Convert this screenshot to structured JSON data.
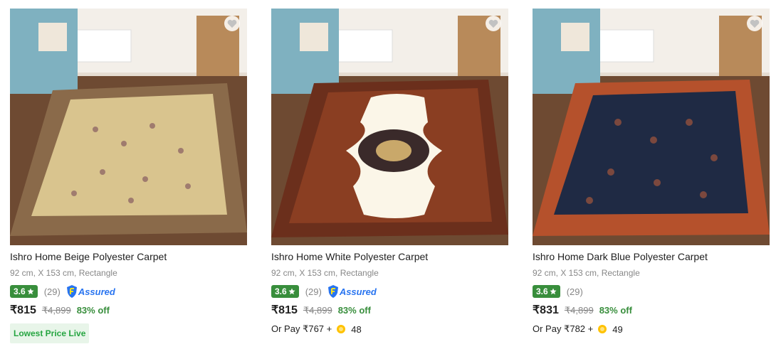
{
  "products": [
    {
      "title": "Ishro Home Beige Polyester Carpet",
      "spec": "92 cm, X 153 cm, Rectangle",
      "rating": "3.6",
      "reviews": "(29)",
      "assured": "Assured",
      "price": "₹815",
      "mrp": "₹4,899",
      "discount": "83% off",
      "extra": "Lowest Price Live",
      "rug_field": "#d9c48e",
      "rug_border": "#8a6a4a"
    },
    {
      "title": "Ishro Home White Polyester Carpet",
      "spec": "92 cm, X 153 cm, Rectangle",
      "rating": "3.6",
      "reviews": "(29)",
      "assured": "Assured",
      "price": "₹815",
      "mrp": "₹4,899",
      "discount": "83% off",
      "or_pay": "Or Pay ₹767 +",
      "coins": "48",
      "rug_field": "#fbf6e8",
      "rug_border": "#6b2f1c"
    },
    {
      "title": "Ishro Home Dark Blue Polyester Carpet",
      "spec": "92 cm, X 153 cm, Rectangle",
      "rating": "3.6",
      "reviews": "(29)",
      "price": "₹831",
      "mrp": "₹4,899",
      "discount": "83% off",
      "or_pay": "Or Pay ₹782 +",
      "coins": "49",
      "rug_field": "#1f2a44",
      "rug_border": "#b5512c"
    }
  ],
  "icons": {
    "star": "star-icon",
    "heart": "heart-icon",
    "assured": "assured-shield-icon",
    "coin": "supercoin-icon"
  }
}
